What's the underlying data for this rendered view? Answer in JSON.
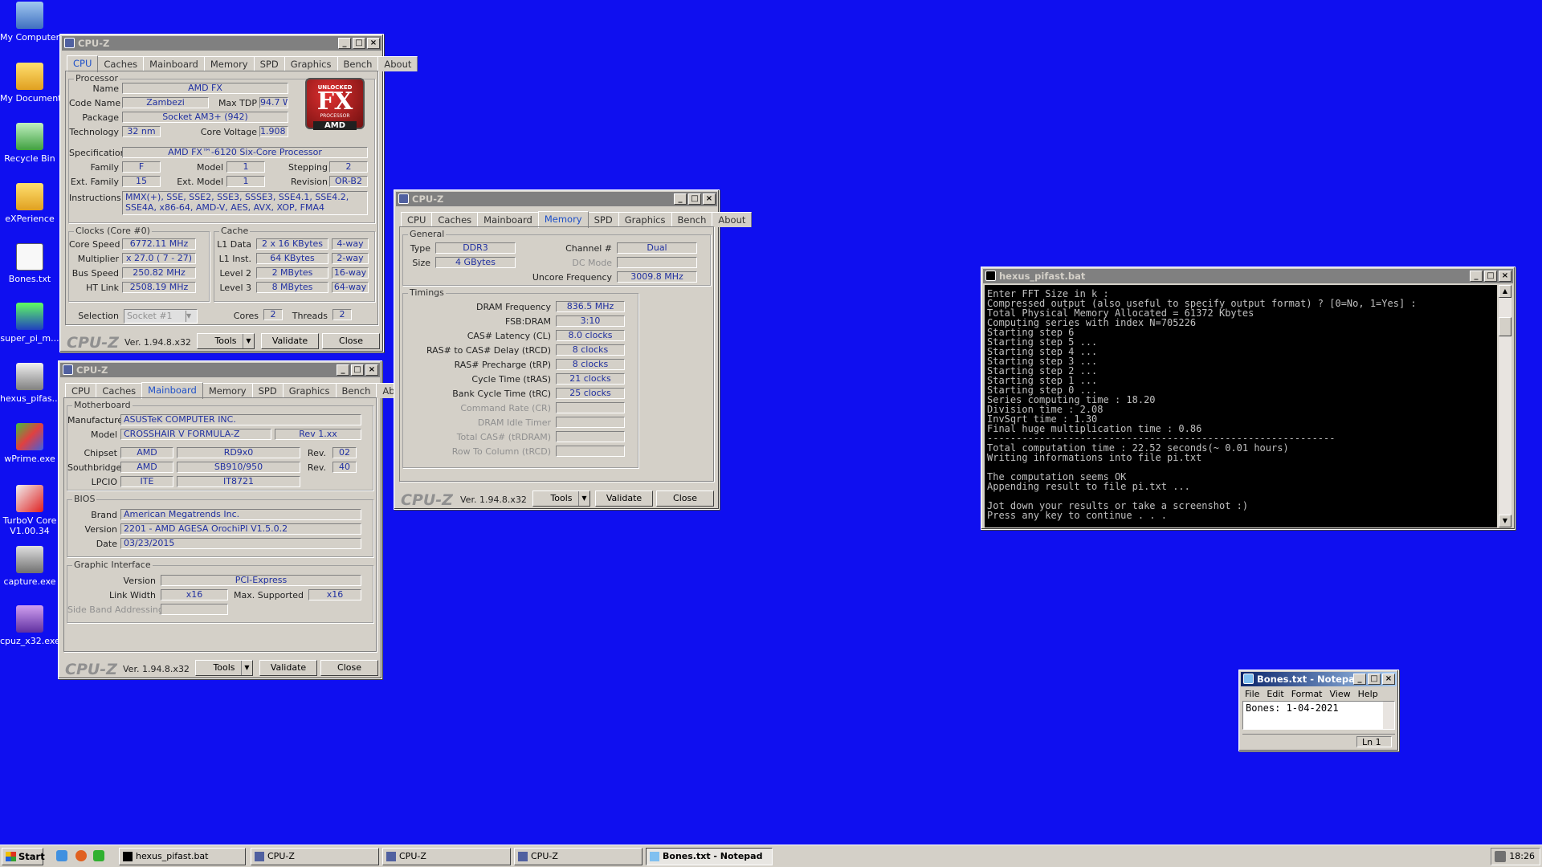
{
  "desktop": {
    "icons": [
      {
        "label": "My Computer"
      },
      {
        "label": "My Documents"
      },
      {
        "label": "Recycle Bin"
      },
      {
        "label": "eXPerience"
      },
      {
        "label": "Bones.txt"
      },
      {
        "label": "super_pi_m..."
      },
      {
        "label": "hexus_pifas..."
      },
      {
        "label": "wPrime.exe"
      },
      {
        "label": "TurboV Core V1.00.34"
      },
      {
        "label": "capture.exe"
      },
      {
        "label": "cpuz_x32.exe"
      }
    ]
  },
  "cpuz_cpu": {
    "title": "CPU-Z",
    "tabs": [
      "CPU",
      "Caches",
      "Mainboard",
      "Memory",
      "SPD",
      "Graphics",
      "Bench",
      "About"
    ],
    "processor_group": "Processor",
    "labels": {
      "name": "Name",
      "code_name": "Code Name",
      "max_tdp": "Max TDP",
      "package": "Package",
      "technology": "Technology",
      "core_voltage": "Core Voltage",
      "specification": "Specification",
      "family": "Family",
      "model": "Model",
      "stepping": "Stepping",
      "ext_family": "Ext. Family",
      "ext_model": "Ext. Model",
      "revision": "Revision",
      "instructions": "Instructions"
    },
    "values": {
      "name": "AMD FX",
      "code_name": "Zambezi",
      "max_tdp": "94.7 W",
      "package": "Socket AM3+ (942)",
      "technology": "32 nm",
      "core_voltage": "1.908 V",
      "specification": "AMD FX™-6120 Six-Core Processor",
      "family": "F",
      "model": "1",
      "stepping": "2",
      "ext_family": "15",
      "ext_model": "1",
      "revision": "OR-B2",
      "instructions": "MMX(+), SSE, SSE2, SSE3, SSSE3, SSE4.1, SSE4.2, SSE4A, x86-64, AMD-V, AES, AVX, XOP, FMA4"
    },
    "logo": {
      "top": "UNLOCKED",
      "main": "FX",
      "sub": "PROCESSOR",
      "brand": "AMD"
    },
    "clocks_group": "Clocks (Core #0)",
    "clocks": {
      "core_speed_label": "Core Speed",
      "core_speed": "6772.11 MHz",
      "multiplier_label": "Multiplier",
      "multiplier": "x 27.0 ( 7 - 27)",
      "bus_speed_label": "Bus Speed",
      "bus_speed": "250.82 MHz",
      "ht_link_label": "HT Link",
      "ht_link": "2508.19 MHz"
    },
    "cache_group": "Cache",
    "cache": {
      "l1d_label": "L1 Data",
      "l1d": "2 x 16 KBytes",
      "l1d_way": "4-way",
      "l1i_label": "L1 Inst.",
      "l1i": "64 KBytes",
      "l1i_way": "2-way",
      "l2_label": "Level 2",
      "l2": "2 MBytes",
      "l2_way": "16-way",
      "l3_label": "Level 3",
      "l3": "8 MBytes",
      "l3_way": "64-way"
    },
    "selection_label": "Selection",
    "selection": "Socket #1",
    "cores_label": "Cores",
    "cores": "2",
    "threads_label": "Threads",
    "threads": "2",
    "footer": {
      "logo": "CPU-Z",
      "version": "Ver. 1.94.8.x32",
      "tools": "Tools",
      "validate": "Validate",
      "close": "Close"
    }
  },
  "cpuz_mainboard": {
    "title": "CPU-Z",
    "tabs": [
      "CPU",
      "Caches",
      "Mainboard",
      "Memory",
      "SPD",
      "Graphics",
      "Bench",
      "About"
    ],
    "motherboard_group": "Motherboard",
    "manufacturer_label": "Manufacturer",
    "manufacturer": "ASUSTeK COMPUTER INC.",
    "model_label": "Model",
    "model": "CROSSHAIR V FORMULA-Z",
    "model_rev": "Rev 1.xx",
    "chipset_label": "Chipset",
    "chipset_vendor": "AMD",
    "chipset": "RD9x0",
    "chipset_rev_label": "Rev.",
    "chipset_rev": "02",
    "southbridge_label": "Southbridge",
    "southbridge_vendor": "AMD",
    "southbridge": "SB910/950",
    "southbridge_rev_label": "Rev.",
    "southbridge_rev": "40",
    "lpcio_label": "LPCIO",
    "lpcio_vendor": "ITE",
    "lpcio": "IT8721",
    "bios_group": "BIOS",
    "brand_label": "Brand",
    "brand": "American Megatrends Inc.",
    "version_label": "Version",
    "version": "2201 - AMD AGESA OrochiPI V1.5.0.2",
    "date_label": "Date",
    "date": "03/23/2015",
    "graphic_group": "Graphic Interface",
    "gi_version_label": "Version",
    "gi_version": "PCI-Express",
    "link_width_label": "Link Width",
    "link_width": "x16",
    "max_supported_label": "Max. Supported",
    "max_supported": "x16",
    "side_band_label": "Side Band Addressing",
    "footer": {
      "logo": "CPU-Z",
      "version": "Ver. 1.94.8.x32",
      "tools": "Tools",
      "validate": "Validate",
      "close": "Close"
    }
  },
  "cpuz_memory": {
    "title": "CPU-Z",
    "tabs": [
      "CPU",
      "Caches",
      "Mainboard",
      "Memory",
      "SPD",
      "Graphics",
      "Bench",
      "About"
    ],
    "general_group": "General",
    "type_label": "Type",
    "type": "DDR3",
    "size_label": "Size",
    "size": "4 GBytes",
    "channel_label": "Channel #",
    "channel": "Dual",
    "dc_mode_label": "DC Mode",
    "uncore_label": "Uncore Frequency",
    "uncore": "3009.8 MHz",
    "timings_group": "Timings",
    "timings": [
      {
        "label": "DRAM Frequency",
        "value": "836.5 MHz",
        "dim": false
      },
      {
        "label": "FSB:DRAM",
        "value": "3:10",
        "dim": false
      },
      {
        "label": "CAS# Latency (CL)",
        "value": "8.0 clocks",
        "dim": false
      },
      {
        "label": "RAS# to CAS# Delay (tRCD)",
        "value": "8 clocks",
        "dim": false
      },
      {
        "label": "RAS# Precharge (tRP)",
        "value": "8 clocks",
        "dim": false
      },
      {
        "label": "Cycle Time (tRAS)",
        "value": "21 clocks",
        "dim": false
      },
      {
        "label": "Bank Cycle Time (tRC)",
        "value": "25 clocks",
        "dim": false
      },
      {
        "label": "Command Rate (CR)",
        "value": "",
        "dim": true
      },
      {
        "label": "DRAM Idle Timer",
        "value": "",
        "dim": true
      },
      {
        "label": "Total CAS# (tRDRAM)",
        "value": "",
        "dim": true
      },
      {
        "label": "Row To Column (tRCD)",
        "value": "",
        "dim": true
      }
    ],
    "footer": {
      "logo": "CPU-Z",
      "version": "Ver. 1.94.8.x32",
      "tools": "Tools",
      "validate": "Validate",
      "close": "Close"
    }
  },
  "console": {
    "title": "hexus_pifast.bat",
    "lines": [
      "Enter FFT Size in k :",
      "Compressed output (also useful to specify output format) ? [0=No, 1=Yes] :",
      "Total Physical Memory Allocated = 61372 Kbytes",
      "Computing series with index N=705226",
      "Starting step 6",
      "Starting step 5 ...",
      "Starting step 4 ...",
      "Starting step 3 ...",
      "Starting step 2 ...",
      "Starting step 1 ...",
      "Starting step 0 ...",
      "Series computing time : 18.20",
      "Division time : 2.08",
      "InvSqrt time : 1.30",
      "Final huge multiplication time : 0.86",
      "------------------------------------------------------------",
      "Total computation time : 22.52 seconds(~ 0.01 hours)",
      "Writing informations into file pi.txt",
      "",
      "The computation seems OK",
      "Appending result to file pi.txt ...",
      "",
      "Jot down your results or take a screenshot :)",
      "Press any key to continue . . ."
    ]
  },
  "notepad": {
    "title": "Bones.txt - Notepad",
    "menu": [
      "File",
      "Edit",
      "Format",
      "View",
      "Help"
    ],
    "content": "Bones: 1-04-2021",
    "status": "Ln 1"
  },
  "taskbar": {
    "start": "Start",
    "tasks": [
      {
        "label": "hexus_pifast.bat",
        "active": false
      },
      {
        "label": "CPU-Z",
        "active": false
      },
      {
        "label": "CPU-Z",
        "active": false
      },
      {
        "label": "CPU-Z",
        "active": false
      },
      {
        "label": "Bones.txt - Notepad",
        "active": true
      }
    ],
    "clock": "18:26"
  },
  "colors": {
    "desktop": "#0f0ff0",
    "titlebar_active": "#0a246a",
    "cpuz_value": "#2030a0"
  }
}
